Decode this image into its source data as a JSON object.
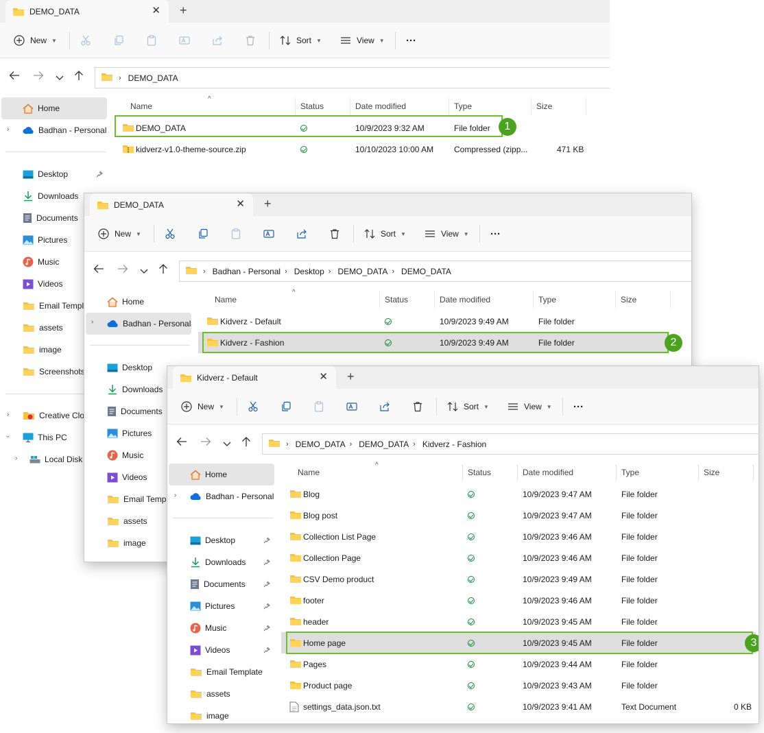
{
  "common": {
    "new_label": "New",
    "sort_label": "Sort",
    "view_label": "View",
    "more_label": "···",
    "plus": "+",
    "close": "✕",
    "col_name": "Name",
    "col_status": "Status",
    "col_date": "Date modified",
    "col_type": "Type",
    "col_size": "Size"
  },
  "win1": {
    "tab_title": "DEMO_DATA",
    "address": [
      "DEMO_DATA"
    ],
    "sidebar": {
      "home": "Home",
      "onedrive": "Badhan - Personal",
      "desktop": "Desktop",
      "downloads": "Downloads",
      "documents": "Documents",
      "pictures": "Pictures",
      "music": "Music",
      "videos": "Videos",
      "email": "Email Templa",
      "assets": "assets",
      "image": "image",
      "screenshots": "Screenshots",
      "creative": "Creative Clou",
      "thispc": "This PC",
      "localdisk": "Local Disk ("
    },
    "rows": [
      {
        "name": "DEMO_DATA",
        "date": "10/9/2023 9:32 AM",
        "type": "File folder",
        "size": ""
      },
      {
        "name": "kidverz-v1.0-theme-source.zip",
        "date": "10/10/2023 10:00 AM",
        "type": "Compressed (zipp...",
        "size": "471 KB"
      }
    ],
    "badge": "1"
  },
  "win2": {
    "tab_title": "DEMO_DATA",
    "address": [
      "Badhan - Personal",
      "Desktop",
      "DEMO_DATA",
      "DEMO_DATA"
    ],
    "sidebar": {
      "home": "Home",
      "onedrive": "Badhan - Personal",
      "desktop": "Desktop",
      "downloads": "Downloads",
      "documents": "Documents",
      "pictures": "Pictures",
      "music": "Music",
      "videos": "Videos",
      "email": "Email Templa",
      "assets": "assets",
      "image": "image"
    },
    "rows": [
      {
        "name": "Kidverz - Default",
        "date": "10/9/2023 9:49 AM",
        "type": "File folder"
      },
      {
        "name": "Kidverz - Fashion",
        "date": "10/9/2023 9:49 AM",
        "type": "File folder"
      }
    ],
    "badge": "2"
  },
  "win3": {
    "tab_title": "Kidverz - Default",
    "address": [
      "DEMO_DATA",
      "DEMO_DATA",
      "Kidverz - Fashion"
    ],
    "sidebar": {
      "home": "Home",
      "onedrive": "Badhan - Personal",
      "desktop": "Desktop",
      "downloads": "Downloads",
      "documents": "Documents",
      "pictures": "Pictures",
      "music": "Music",
      "videos": "Videos",
      "email": "Email Template",
      "assets": "assets",
      "image": "image"
    },
    "rows": [
      {
        "name": "Blog",
        "date": "10/9/2023 9:47 AM",
        "type": "File folder",
        "size": ""
      },
      {
        "name": "Blog post",
        "date": "10/9/2023 9:47 AM",
        "type": "File folder",
        "size": ""
      },
      {
        "name": "Collection List Page",
        "date": "10/9/2023 9:46 AM",
        "type": "File folder",
        "size": ""
      },
      {
        "name": "Collection Page",
        "date": "10/9/2023 9:46 AM",
        "type": "File folder",
        "size": ""
      },
      {
        "name": "CSV Demo product",
        "date": "10/9/2023 9:49 AM",
        "type": "File folder",
        "size": ""
      },
      {
        "name": "footer",
        "date": "10/9/2023 9:46 AM",
        "type": "File folder",
        "size": ""
      },
      {
        "name": "header",
        "date": "10/9/2023 9:45 AM",
        "type": "File folder",
        "size": ""
      },
      {
        "name": "Home page",
        "date": "10/9/2023 9:45 AM",
        "type": "File folder",
        "size": ""
      },
      {
        "name": "Pages",
        "date": "10/9/2023 9:44 AM",
        "type": "File folder",
        "size": ""
      },
      {
        "name": "Product page",
        "date": "10/9/2023 9:43 AM",
        "type": "File folder",
        "size": ""
      },
      {
        "name": "settings_data.json.txt",
        "date": "10/9/2023 9:41 AM",
        "type": "Text Document",
        "size": "0 KB"
      }
    ],
    "badge": "3"
  },
  "colors": {
    "highlight": "#6abf2a",
    "badge": "#4ba21f",
    "folder": "#f5c242",
    "selection": "#dedede"
  }
}
